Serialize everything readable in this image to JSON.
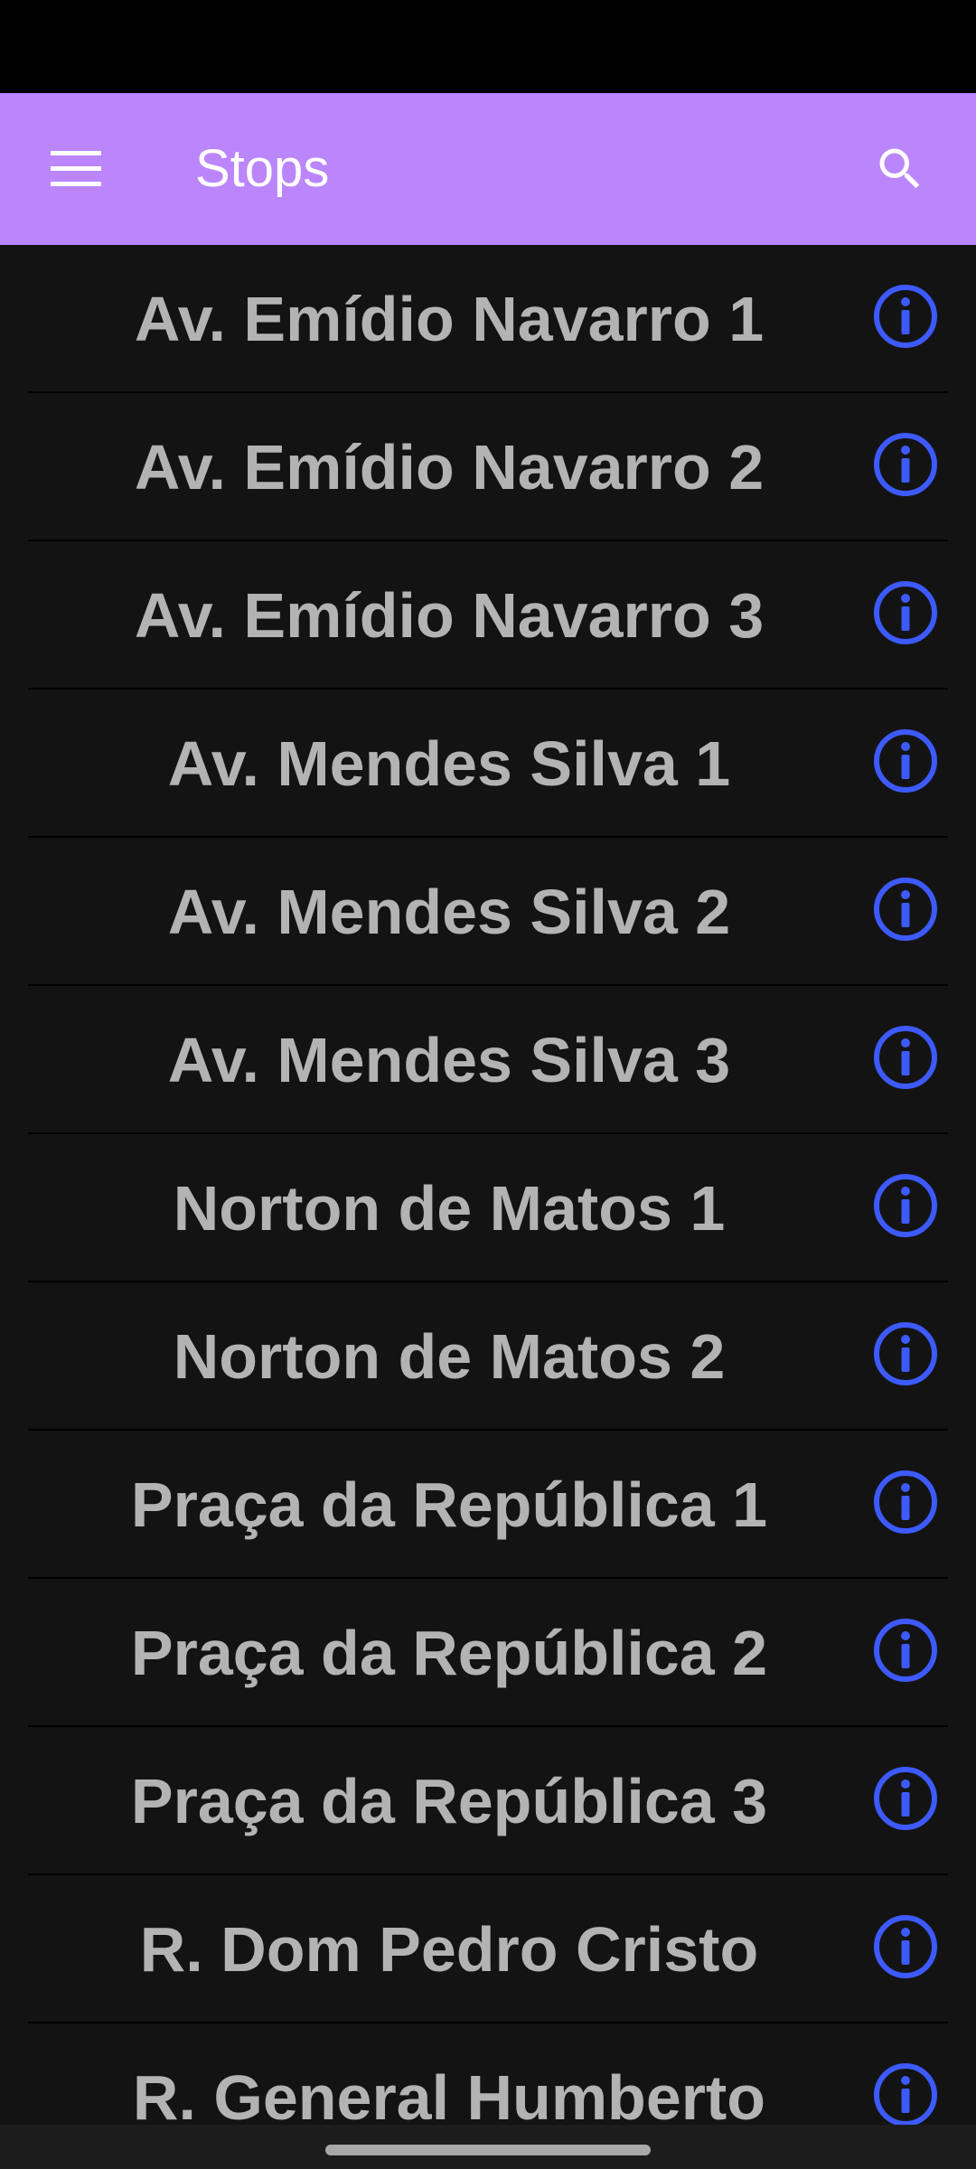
{
  "status_bar": {},
  "app_bar": {
    "title": "Stops",
    "menu_icon": "menu-icon",
    "search_icon": "search-icon",
    "background_color": "#bb86fc"
  },
  "stops": [
    {
      "name": "Av. Emídio Navarro 1"
    },
    {
      "name": "Av. Emídio Navarro 2"
    },
    {
      "name": "Av. Emídio Navarro 3"
    },
    {
      "name": "Av. Mendes Silva 1"
    },
    {
      "name": "Av. Mendes Silva 2"
    },
    {
      "name": "Av. Mendes Silva 3"
    },
    {
      "name": "Norton de Matos 1"
    },
    {
      "name": "Norton de Matos 2"
    },
    {
      "name": "Praça da República 1"
    },
    {
      "name": "Praça da República 2"
    },
    {
      "name": "Praça da República 3"
    },
    {
      "name": "R. Dom Pedro Cristo"
    },
    {
      "name": "R. General Humberto"
    }
  ],
  "info_icon": "info-icon",
  "colors": {
    "info_icon": "#3d5afe",
    "stop_text": "#b3b3b3",
    "background": "#131313"
  }
}
